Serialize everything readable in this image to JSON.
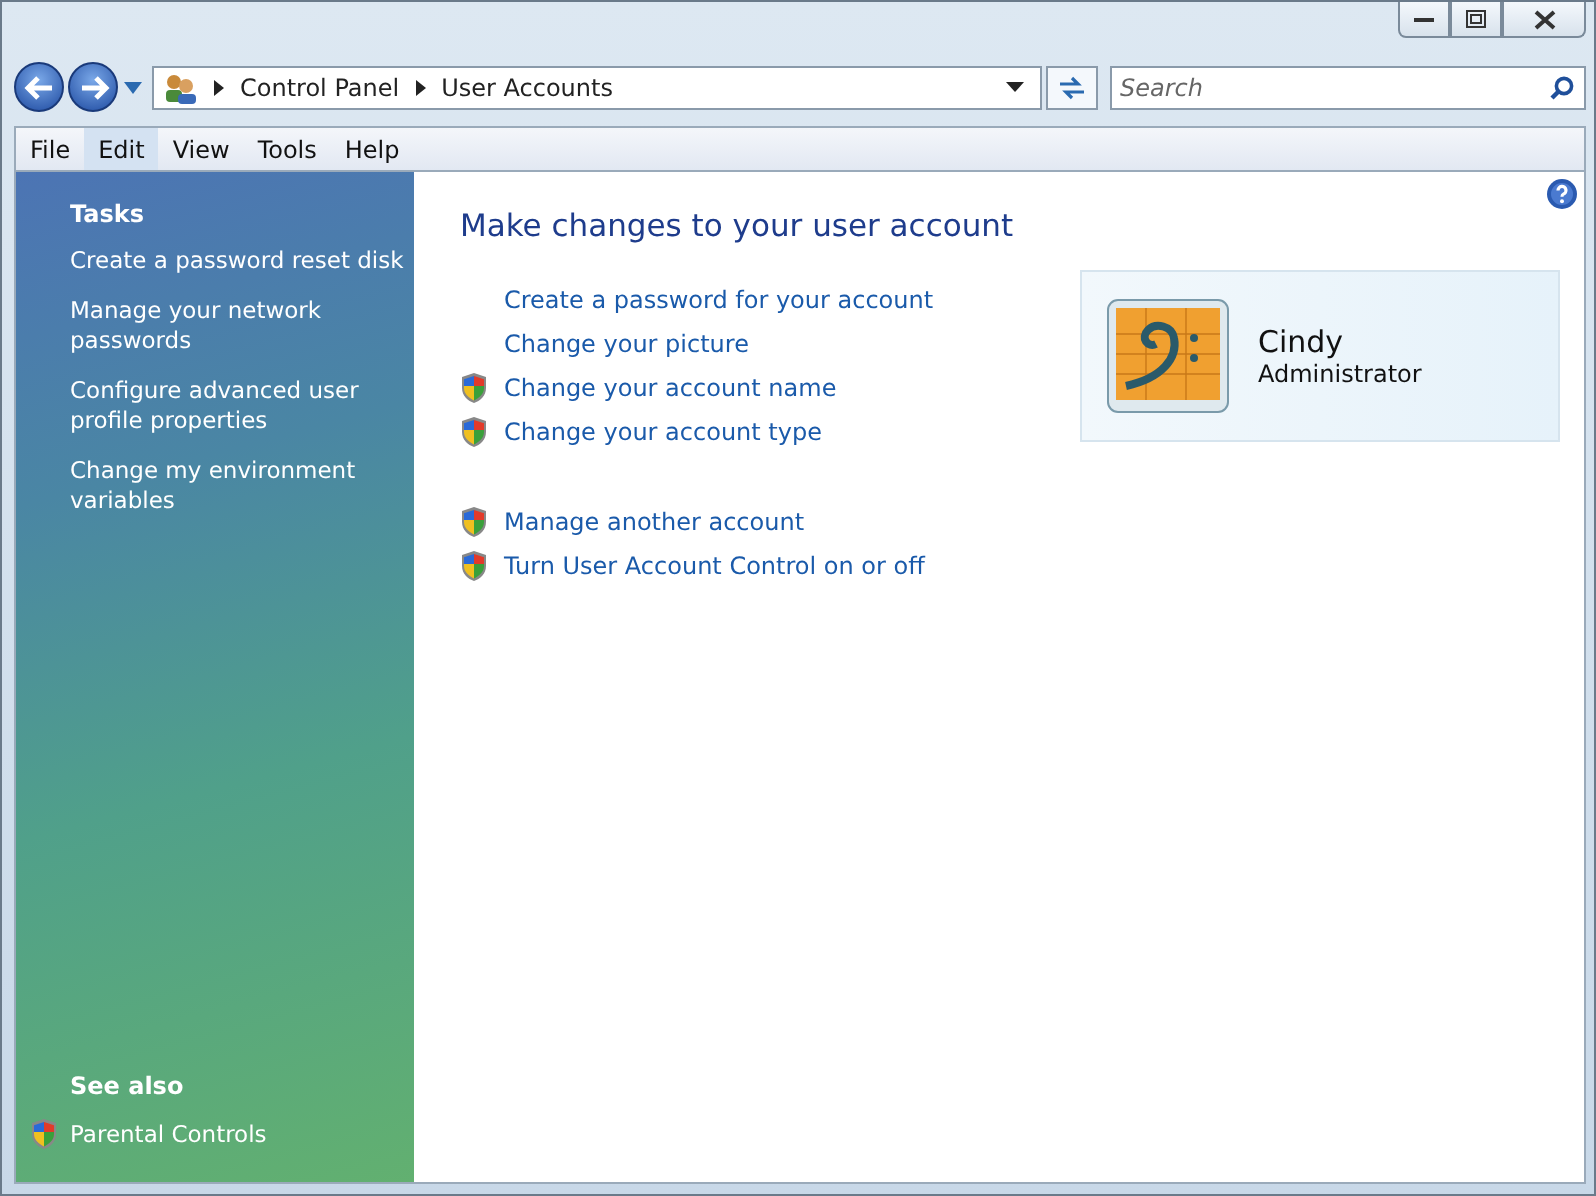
{
  "address_bar": {
    "breadcrumbs": [
      "Control Panel",
      "User Accounts"
    ]
  },
  "search": {
    "placeholder": "Search"
  },
  "menu": [
    {
      "label": "File",
      "selected": false
    },
    {
      "label": "Edit",
      "selected": true
    },
    {
      "label": "View",
      "selected": false
    },
    {
      "label": "Tools",
      "selected": false
    },
    {
      "label": "Help",
      "selected": false
    }
  ],
  "sidebar": {
    "tasks_title": "Tasks",
    "tasks": [
      {
        "label": "Create a password reset disk"
      },
      {
        "label": "Manage your network passwords"
      },
      {
        "label": "Configure advanced user profile properties"
      },
      {
        "label": "Change my environment variables"
      }
    ],
    "see_also_title": "See also",
    "see_also": [
      {
        "label": "Parental Controls",
        "shield": true
      }
    ]
  },
  "main": {
    "title": "Make changes to your user account",
    "link_groups": [
      [
        {
          "label": "Create a password for your account",
          "shield": false
        },
        {
          "label": "Change your picture",
          "shield": false
        },
        {
          "label": "Change your account name",
          "shield": true
        },
        {
          "label": "Change your account type",
          "shield": true
        }
      ],
      [
        {
          "label": "Manage another account",
          "shield": true
        },
        {
          "label": "Turn User Account Control on or off",
          "shield": true
        }
      ]
    ]
  },
  "account": {
    "name": "Cindy",
    "role": "Administrator"
  }
}
